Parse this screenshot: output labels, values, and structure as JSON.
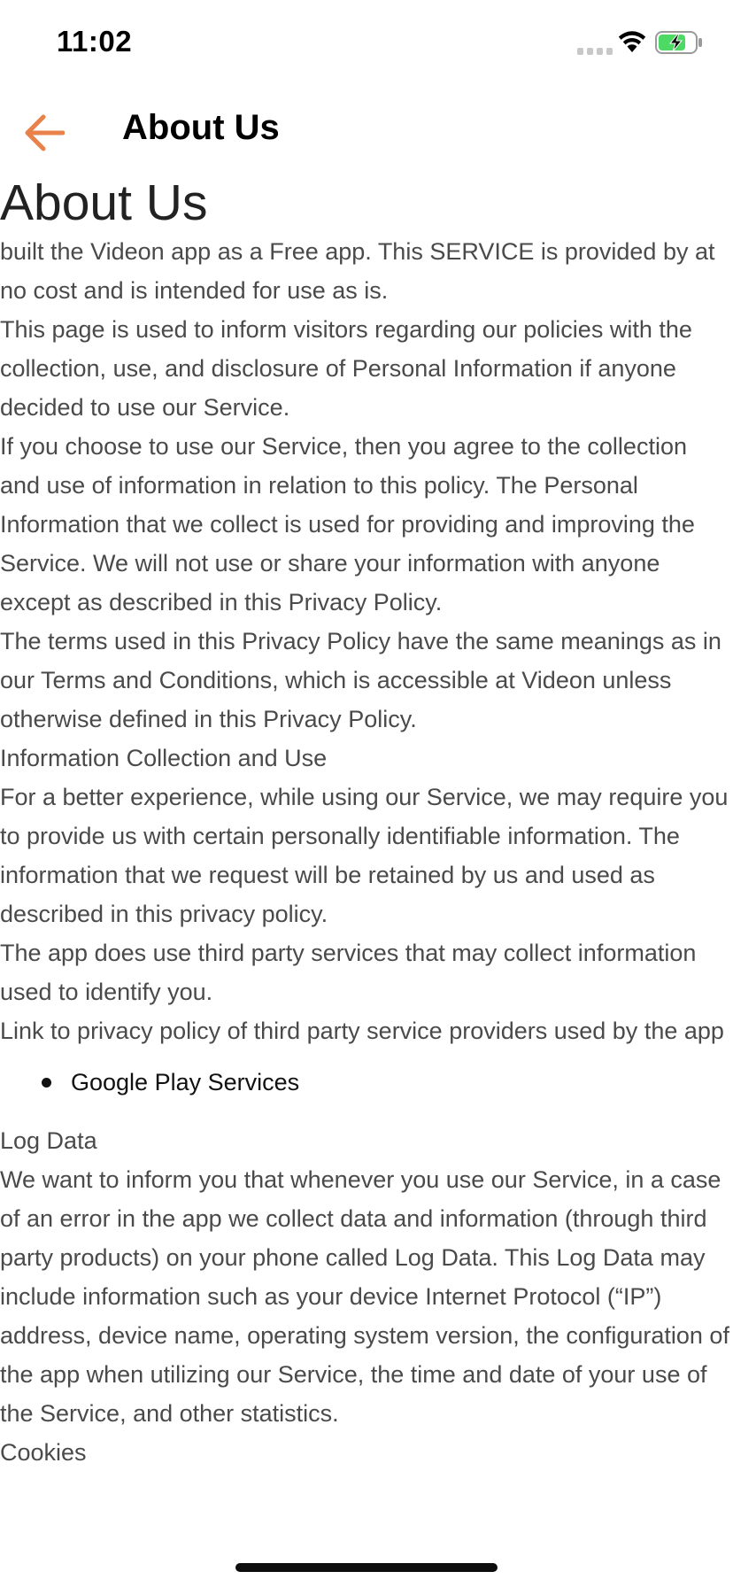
{
  "status_bar": {
    "time": "11:02",
    "icons": [
      "cellular-signal-icon",
      "wifi-icon",
      "battery-charging-icon"
    ]
  },
  "nav": {
    "back_icon": "arrow-left-icon",
    "title": "About Us",
    "accent_color": "#E8824A"
  },
  "content": {
    "heading": "About Us",
    "paragraphs_before_list": [
      "built the Videon app as a Free app. This SERVICE is provided by at no cost and is intended for use as is.",
      "This page is used to inform visitors regarding our policies with the collection, use, and disclosure of Personal Information if anyone decided to use our Service.",
      "If you choose to use our Service, then you agree to the collection and use of information in relation to this policy. The Personal Information that we collect is used for providing and improving the Service. We will not use or share your information with anyone except as described in this Privacy Policy.",
      "The terms used in this Privacy Policy have the same meanings as in our Terms and Conditions, which is accessible at Videon unless otherwise defined in this Privacy Policy.",
      "Information Collection and Use",
      "For a better experience, while using our Service, we may require you to provide us with certain personally identifiable information. The information that we request will be retained by us and used as described in this privacy policy.",
      "The app does use third party services that may collect information used to identify you.",
      "Link to privacy policy of third party service providers used by the app"
    ],
    "list_items": [
      "Google Play Services"
    ],
    "paragraphs_after_list": [
      "Log Data",
      "We want to inform you that whenever you use our Service, in a case of an error in the app we collect data and information (through third party products) on your phone called Log Data. This Log Data may include information such as your device Internet Protocol (“IP”) address, device name, operating system version, the configuration of the app when utilizing our Service, the time and date of your use of the Service, and other statistics.",
      "Cookies"
    ]
  }
}
